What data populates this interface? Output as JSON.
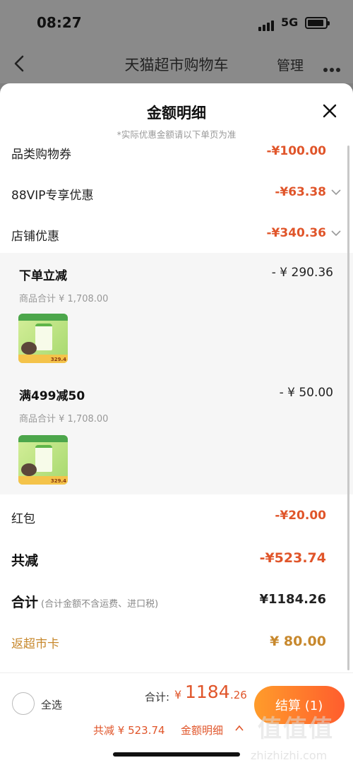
{
  "status_bar": {
    "time": "08:27",
    "network": "5G"
  },
  "nav": {
    "title": "天猫超市购物车",
    "manage": "管理"
  },
  "sheet": {
    "title": "金额明细",
    "subtitle": "*实际优惠金额请以下单页为准",
    "rows": {
      "category_coupon": {
        "label": "品类购物券",
        "amount": "-¥100.00"
      },
      "vip88": {
        "label": "88VIP专享优惠",
        "amount": "-¥63.38"
      },
      "store": {
        "label": "店铺优惠",
        "amount": "-¥340.36"
      }
    },
    "store_details": [
      {
        "title": "下单立减",
        "amount": "- ¥ 290.36",
        "subtotal": "商品合计 ¥ 1,708.00",
        "thumb_tag": "329.4"
      },
      {
        "title": "满499减50",
        "amount": "- ¥ 50.00",
        "subtotal": "商品合计 ¥ 1,708.00",
        "thumb_tag": "329.4"
      }
    ],
    "red_packet": {
      "label": "红包",
      "amount": "-¥20.00"
    },
    "total_reduce": {
      "label": "共减",
      "amount": "-¥523.74"
    },
    "total": {
      "label": "合计",
      "note": "(合计金额不含运费、进口税)",
      "amount": "¥1184.26"
    },
    "cashback": {
      "label": "返超市卡",
      "amount": "¥ 80.00"
    }
  },
  "bottom": {
    "select_all": "全选",
    "sum_label": "合计:",
    "currency": "¥",
    "sum_int": "1184",
    "sum_dec": ".26",
    "reduce": "共减 ¥ 523.74",
    "detail_link": "金额明细",
    "checkout": "结算 (1)"
  },
  "watermark": {
    "logo": "值值值",
    "url": "zhizhizhi.com"
  },
  "colors": {
    "accent": "#e0552a",
    "gold": "#c7882d",
    "checkout_start": "#ff9c2b",
    "checkout_end": "#ff5d2d"
  }
}
